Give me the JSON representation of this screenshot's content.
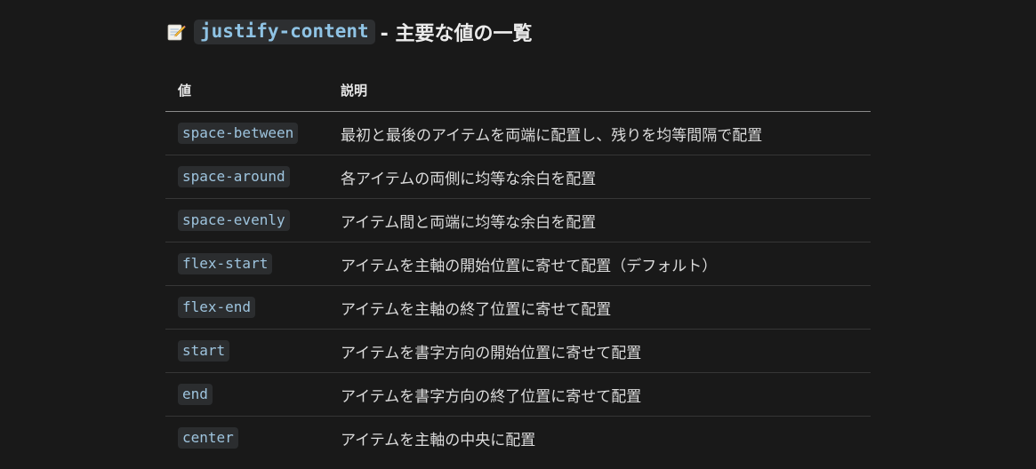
{
  "heading": {
    "icon": "memo-icon",
    "code": "justify-content",
    "rest": "- 主要な値の一覧"
  },
  "table": {
    "headers": [
      "値",
      "説明"
    ],
    "rows": [
      {
        "value": "space-between",
        "description": "最初と最後のアイテムを両端に配置し、残りを均等間隔で配置"
      },
      {
        "value": "space-around",
        "description": "各アイテムの両側に均等な余白を配置"
      },
      {
        "value": "space-evenly",
        "description": "アイテム間と両端に均等な余白を配置"
      },
      {
        "value": "flex-start",
        "description": "アイテムを主軸の開始位置に寄せて配置（デフォルト）"
      },
      {
        "value": "flex-end",
        "description": "アイテムを主軸の終了位置に寄せて配置"
      },
      {
        "value": "start",
        "description": "アイテムを書字方向の開始位置に寄せて配置"
      },
      {
        "value": "end",
        "description": "アイテムを書字方向の終了位置に寄せて配置"
      },
      {
        "value": "center",
        "description": "アイテムを主軸の中央に配置"
      }
    ]
  }
}
